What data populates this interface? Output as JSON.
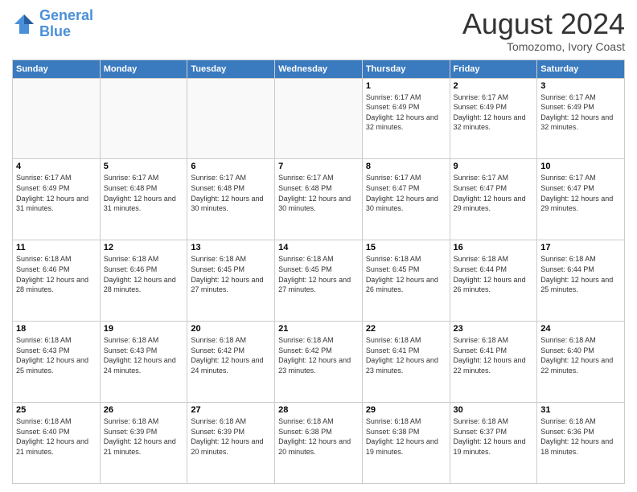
{
  "header": {
    "logo_line1": "General",
    "logo_line2": "Blue",
    "main_title": "August 2024",
    "subtitle": "Tomozomo, Ivory Coast"
  },
  "days_of_week": [
    "Sunday",
    "Monday",
    "Tuesday",
    "Wednesday",
    "Thursday",
    "Friday",
    "Saturday"
  ],
  "weeks": [
    [
      {
        "day": "",
        "info": ""
      },
      {
        "day": "",
        "info": ""
      },
      {
        "day": "",
        "info": ""
      },
      {
        "day": "",
        "info": ""
      },
      {
        "day": "1",
        "info": "Sunrise: 6:17 AM\nSunset: 6:49 PM\nDaylight: 12 hours and 32 minutes."
      },
      {
        "day": "2",
        "info": "Sunrise: 6:17 AM\nSunset: 6:49 PM\nDaylight: 12 hours and 32 minutes."
      },
      {
        "day": "3",
        "info": "Sunrise: 6:17 AM\nSunset: 6:49 PM\nDaylight: 12 hours and 32 minutes."
      }
    ],
    [
      {
        "day": "4",
        "info": "Sunrise: 6:17 AM\nSunset: 6:49 PM\nDaylight: 12 hours and 31 minutes."
      },
      {
        "day": "5",
        "info": "Sunrise: 6:17 AM\nSunset: 6:48 PM\nDaylight: 12 hours and 31 minutes."
      },
      {
        "day": "6",
        "info": "Sunrise: 6:17 AM\nSunset: 6:48 PM\nDaylight: 12 hours and 30 minutes."
      },
      {
        "day": "7",
        "info": "Sunrise: 6:17 AM\nSunset: 6:48 PM\nDaylight: 12 hours and 30 minutes."
      },
      {
        "day": "8",
        "info": "Sunrise: 6:17 AM\nSunset: 6:47 PM\nDaylight: 12 hours and 30 minutes."
      },
      {
        "day": "9",
        "info": "Sunrise: 6:17 AM\nSunset: 6:47 PM\nDaylight: 12 hours and 29 minutes."
      },
      {
        "day": "10",
        "info": "Sunrise: 6:17 AM\nSunset: 6:47 PM\nDaylight: 12 hours and 29 minutes."
      }
    ],
    [
      {
        "day": "11",
        "info": "Sunrise: 6:18 AM\nSunset: 6:46 PM\nDaylight: 12 hours and 28 minutes."
      },
      {
        "day": "12",
        "info": "Sunrise: 6:18 AM\nSunset: 6:46 PM\nDaylight: 12 hours and 28 minutes."
      },
      {
        "day": "13",
        "info": "Sunrise: 6:18 AM\nSunset: 6:45 PM\nDaylight: 12 hours and 27 minutes."
      },
      {
        "day": "14",
        "info": "Sunrise: 6:18 AM\nSunset: 6:45 PM\nDaylight: 12 hours and 27 minutes."
      },
      {
        "day": "15",
        "info": "Sunrise: 6:18 AM\nSunset: 6:45 PM\nDaylight: 12 hours and 26 minutes."
      },
      {
        "day": "16",
        "info": "Sunrise: 6:18 AM\nSunset: 6:44 PM\nDaylight: 12 hours and 26 minutes."
      },
      {
        "day": "17",
        "info": "Sunrise: 6:18 AM\nSunset: 6:44 PM\nDaylight: 12 hours and 25 minutes."
      }
    ],
    [
      {
        "day": "18",
        "info": "Sunrise: 6:18 AM\nSunset: 6:43 PM\nDaylight: 12 hours and 25 minutes."
      },
      {
        "day": "19",
        "info": "Sunrise: 6:18 AM\nSunset: 6:43 PM\nDaylight: 12 hours and 24 minutes."
      },
      {
        "day": "20",
        "info": "Sunrise: 6:18 AM\nSunset: 6:42 PM\nDaylight: 12 hours and 24 minutes."
      },
      {
        "day": "21",
        "info": "Sunrise: 6:18 AM\nSunset: 6:42 PM\nDaylight: 12 hours and 23 minutes."
      },
      {
        "day": "22",
        "info": "Sunrise: 6:18 AM\nSunset: 6:41 PM\nDaylight: 12 hours and 23 minutes."
      },
      {
        "day": "23",
        "info": "Sunrise: 6:18 AM\nSunset: 6:41 PM\nDaylight: 12 hours and 22 minutes."
      },
      {
        "day": "24",
        "info": "Sunrise: 6:18 AM\nSunset: 6:40 PM\nDaylight: 12 hours and 22 minutes."
      }
    ],
    [
      {
        "day": "25",
        "info": "Sunrise: 6:18 AM\nSunset: 6:40 PM\nDaylight: 12 hours and 21 minutes."
      },
      {
        "day": "26",
        "info": "Sunrise: 6:18 AM\nSunset: 6:39 PM\nDaylight: 12 hours and 21 minutes."
      },
      {
        "day": "27",
        "info": "Sunrise: 6:18 AM\nSunset: 6:39 PM\nDaylight: 12 hours and 20 minutes."
      },
      {
        "day": "28",
        "info": "Sunrise: 6:18 AM\nSunset: 6:38 PM\nDaylight: 12 hours and 20 minutes."
      },
      {
        "day": "29",
        "info": "Sunrise: 6:18 AM\nSunset: 6:38 PM\nDaylight: 12 hours and 19 minutes."
      },
      {
        "day": "30",
        "info": "Sunrise: 6:18 AM\nSunset: 6:37 PM\nDaylight: 12 hours and 19 minutes."
      },
      {
        "day": "31",
        "info": "Sunrise: 6:18 AM\nSunset: 6:36 PM\nDaylight: 12 hours and 18 minutes."
      }
    ]
  ]
}
